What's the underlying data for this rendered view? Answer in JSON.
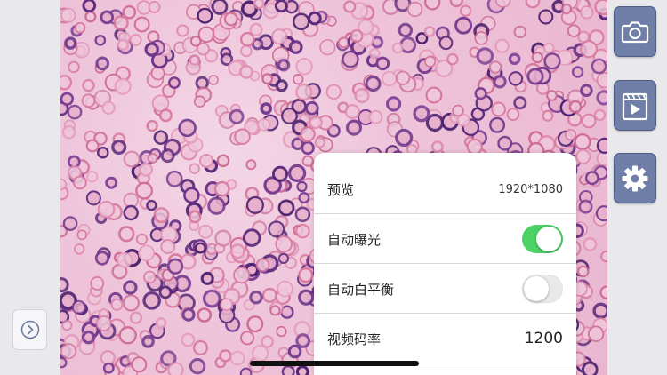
{
  "settings": {
    "rows": [
      {
        "label": "预览",
        "value": "1920*1080"
      },
      {
        "label": "自动曝光",
        "toggle": true
      },
      {
        "label": "自动白平衡",
        "toggle": false
      },
      {
        "label": "视频码率",
        "value": "1200"
      }
    ]
  },
  "sidebar": {
    "buttons": [
      "camera-icon",
      "video-icon",
      "gear-icon"
    ],
    "accent": "#6f7fa7"
  },
  "left": {
    "expand_icon": "chevron-right-circle-icon"
  },
  "colors": {
    "toggle_on": "#4cd164",
    "toggle_off": "#e9e9eb"
  }
}
